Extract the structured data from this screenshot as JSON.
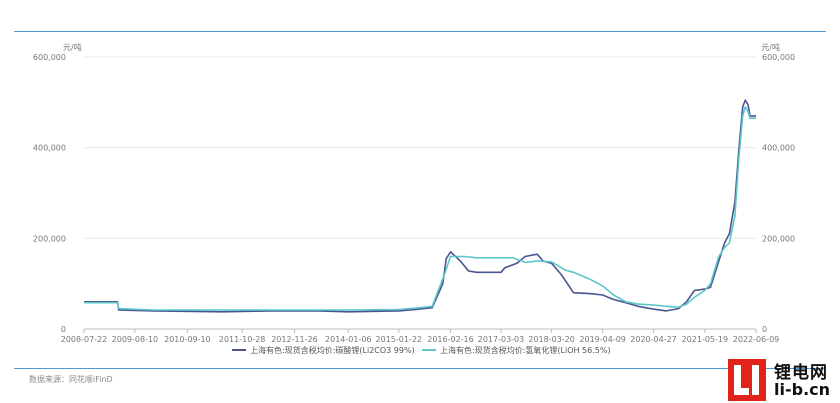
{
  "chart_data": {
    "type": "line",
    "y_unit_left": "元/吨",
    "y_unit_right": "元/吨",
    "ylim": [
      0,
      600000
    ],
    "y_ticks": [
      0,
      200000,
      400000,
      600000
    ],
    "y_tick_labels": [
      "0",
      "200,000",
      "400,000",
      "600,000"
    ],
    "xlim": [
      "2008-07-22",
      "2022-06-09"
    ],
    "x_ticks": [
      "2008-07-22",
      "2009-08-10",
      "2010-09-10",
      "2011-10-28",
      "2012-11-26",
      "2014-01-06",
      "2015-01-22",
      "2016-02-16",
      "2017-03-03",
      "2018-03-20",
      "2019-04-09",
      "2020-04-27",
      "2021-05-19",
      "2022-06-09"
    ],
    "grid": true,
    "legend_position": "bottom",
    "series": [
      {
        "name": "上海有色:现货含税均价:碳酸锂(Li2CO3 99%)",
        "color": "#4a5590",
        "points": [
          [
            "2008-07-22",
            60000
          ],
          [
            "2009-04-01",
            60000
          ],
          [
            "2009-04-10",
            42000
          ],
          [
            "2010-01-01",
            40000
          ],
          [
            "2011-06-01",
            38000
          ],
          [
            "2012-06-01",
            40000
          ],
          [
            "2013-06-01",
            40000
          ],
          [
            "2014-01-06",
            38000
          ],
          [
            "2015-01-22",
            40000
          ],
          [
            "2015-06-01",
            43000
          ],
          [
            "2015-10-01",
            47000
          ],
          [
            "2015-12-20",
            100000
          ],
          [
            "2016-01-15",
            155000
          ],
          [
            "2016-02-16",
            170000
          ],
          [
            "2016-05-01",
            150000
          ],
          [
            "2016-07-01",
            128000
          ],
          [
            "2016-09-01",
            125000
          ],
          [
            "2017-01-01",
            125000
          ],
          [
            "2017-03-03",
            125000
          ],
          [
            "2017-04-01",
            135000
          ],
          [
            "2017-07-01",
            145000
          ],
          [
            "2017-09-01",
            160000
          ],
          [
            "2017-12-01",
            165000
          ],
          [
            "2018-01-15",
            150000
          ],
          [
            "2018-03-20",
            145000
          ],
          [
            "2018-06-01",
            120000
          ],
          [
            "2018-09-01",
            80000
          ],
          [
            "2019-01-01",
            78000
          ],
          [
            "2019-04-09",
            75000
          ],
          [
            "2019-07-01",
            65000
          ],
          [
            "2019-10-01",
            58000
          ],
          [
            "2020-01-01",
            50000
          ],
          [
            "2020-04-27",
            44000
          ],
          [
            "2020-08-01",
            40000
          ],
          [
            "2020-11-01",
            45000
          ],
          [
            "2021-01-01",
            60000
          ],
          [
            "2021-03-01",
            85000
          ],
          [
            "2021-05-19",
            88000
          ],
          [
            "2021-07-01",
            92000
          ],
          [
            "2021-09-01",
            150000
          ],
          [
            "2021-10-15",
            190000
          ],
          [
            "2021-11-20",
            210000
          ],
          [
            "2022-01-01",
            280000
          ],
          [
            "2022-02-01",
            400000
          ],
          [
            "2022-03-01",
            490000
          ],
          [
            "2022-03-20",
            505000
          ],
          [
            "2022-04-10",
            495000
          ],
          [
            "2022-04-25",
            470000
          ],
          [
            "2022-06-09",
            470000
          ]
        ]
      },
      {
        "name": "上海有色:现货含税均价:氢氧化锂(LiOH 56.5%)",
        "color": "#5cc6c8",
        "points": [
          [
            "2008-07-22",
            58000
          ],
          [
            "2009-04-01",
            58000
          ],
          [
            "2009-04-10",
            45000
          ],
          [
            "2010-01-01",
            42000
          ],
          [
            "2011-06-01",
            42000
          ],
          [
            "2012-06-01",
            42000
          ],
          [
            "2013-06-01",
            42000
          ],
          [
            "2014-01-06",
            42000
          ],
          [
            "2015-01-22",
            43000
          ],
          [
            "2015-06-01",
            46000
          ],
          [
            "2015-10-01",
            50000
          ],
          [
            "2016-01-01",
            120000
          ],
          [
            "2016-02-16",
            160000
          ],
          [
            "2016-06-01",
            160000
          ],
          [
            "2016-09-01",
            157000
          ],
          [
            "2017-01-01",
            157000
          ],
          [
            "2017-03-03",
            157000
          ],
          [
            "2017-06-01",
            157000
          ],
          [
            "2017-09-01",
            147000
          ],
          [
            "2017-12-01",
            150000
          ],
          [
            "2018-03-20",
            148000
          ],
          [
            "2018-07-01",
            130000
          ],
          [
            "2018-09-01",
            125000
          ],
          [
            "2019-01-01",
            110000
          ],
          [
            "2019-04-09",
            95000
          ],
          [
            "2019-07-01",
            75000
          ],
          [
            "2019-10-01",
            60000
          ],
          [
            "2020-01-01",
            55000
          ],
          [
            "2020-04-27",
            53000
          ],
          [
            "2020-08-01",
            50000
          ],
          [
            "2020-11-01",
            48000
          ],
          [
            "2021-01-01",
            55000
          ],
          [
            "2021-03-01",
            70000
          ],
          [
            "2021-05-19",
            85000
          ],
          [
            "2021-07-01",
            100000
          ],
          [
            "2021-09-01",
            160000
          ],
          [
            "2021-10-15",
            180000
          ],
          [
            "2021-11-20",
            190000
          ],
          [
            "2022-01-01",
            250000
          ],
          [
            "2022-02-01",
            380000
          ],
          [
            "2022-03-01",
            470000
          ],
          [
            "2022-03-20",
            490000
          ],
          [
            "2022-04-10",
            480000
          ],
          [
            "2022-04-25",
            465000
          ],
          [
            "2022-06-09",
            465000
          ]
        ]
      }
    ]
  },
  "footer": {
    "source": "数据来源：同花顺iFinD",
    "logo_cn": "锂电网",
    "logo_en": "li-b.cn"
  }
}
